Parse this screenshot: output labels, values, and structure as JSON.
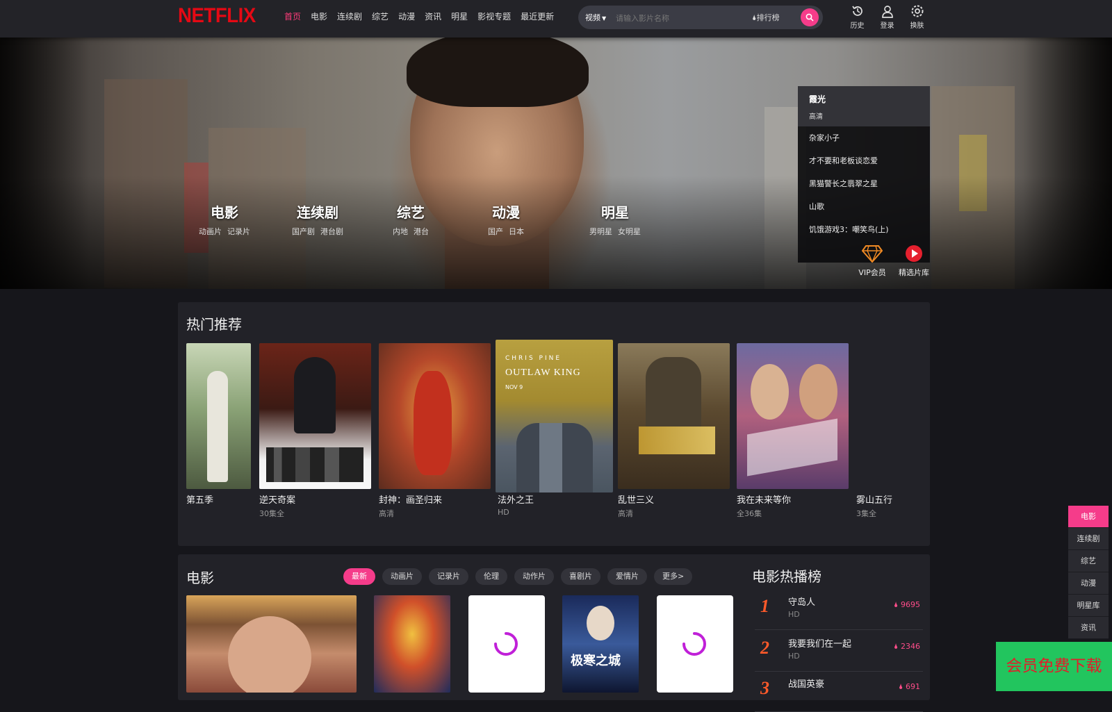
{
  "brand": {
    "logo_text": "NETFLIX",
    "logo_color": "#e50914",
    "accent": "#f53c8a"
  },
  "nav": [
    {
      "label": "首页",
      "active": true
    },
    {
      "label": "电影"
    },
    {
      "label": "连续剧"
    },
    {
      "label": "综艺"
    },
    {
      "label": "动漫"
    },
    {
      "label": "资讯"
    },
    {
      "label": "明星"
    },
    {
      "label": "影视专题"
    },
    {
      "label": "最近更新"
    }
  ],
  "search": {
    "type_label": "视频",
    "placeholder": "请输入影片名称",
    "rank_label": "排行榜"
  },
  "tools": [
    {
      "label": "历史",
      "icon": "history-icon"
    },
    {
      "label": "登录",
      "icon": "user-icon"
    },
    {
      "label": "换肤",
      "icon": "gear-icon"
    }
  ],
  "banner": {
    "categories": [
      {
        "title": "电影",
        "subs": [
          "动画片",
          "记录片"
        ]
      },
      {
        "title": "连续剧",
        "subs": [
          "国产剧",
          "港台剧"
        ]
      },
      {
        "title": "综艺",
        "subs": [
          "内地",
          "港台"
        ]
      },
      {
        "title": "动漫",
        "subs": [
          "国产",
          "日本"
        ]
      },
      {
        "title": "明星",
        "subs": [
          "男明星",
          "女明星"
        ]
      }
    ],
    "playlist": {
      "current": {
        "name": "霞光",
        "quality": "高清"
      },
      "items": [
        "杂家小子",
        "才不要和老板谈恋爱",
        "黑猫警长之翡翠之星",
        "山歌",
        "饥饿游戏3：嘲笑鸟(上)"
      ]
    },
    "quick": [
      {
        "label": "VIP会员",
        "icon": "diamond-icon"
      },
      {
        "label": "精选片库",
        "icon": "play-icon"
      }
    ]
  },
  "hot": {
    "title": "热门推荐",
    "items": [
      {
        "name": "第五季",
        "status": ""
      },
      {
        "name": "逆天奇案",
        "status": "30集全"
      },
      {
        "name": "封神：画圣归来",
        "status": "高清"
      },
      {
        "name": "法外之王",
        "status": "HD"
      },
      {
        "name": "乱世三义",
        "status": "高清"
      },
      {
        "name": "我在未来等你",
        "status": "全36集"
      },
      {
        "name": "雾山五行",
        "status": "3集全"
      }
    ],
    "poster_text": {
      "outlaw_top": "CHRIS PINE",
      "outlaw_title": "OUTLAW KING",
      "outlaw_date": "NOV 9"
    }
  },
  "movie": {
    "title": "电影",
    "filters": [
      "最新",
      "动画片",
      "记录片",
      "伦理",
      "动作片",
      "喜剧片",
      "爱情片",
      "更多>"
    ],
    "poster_text": {
      "p4": "极寒之城"
    },
    "rank_title": "电影热播榜",
    "rank": [
      {
        "num": "1",
        "name": "守岛人",
        "status": "HD",
        "heat": "9695"
      },
      {
        "num": "2",
        "name": "我要我们在一起",
        "status": "HD",
        "heat": "2346"
      },
      {
        "num": "3",
        "name": "战国英豪",
        "status": "",
        "heat": "691"
      }
    ]
  },
  "sidenav": [
    {
      "label": "电影",
      "active": true
    },
    {
      "label": "连续剧"
    },
    {
      "label": "综艺"
    },
    {
      "label": "动漫"
    },
    {
      "label": "明星库"
    },
    {
      "label": "资讯"
    }
  ],
  "vip_download": "会员免费下载"
}
